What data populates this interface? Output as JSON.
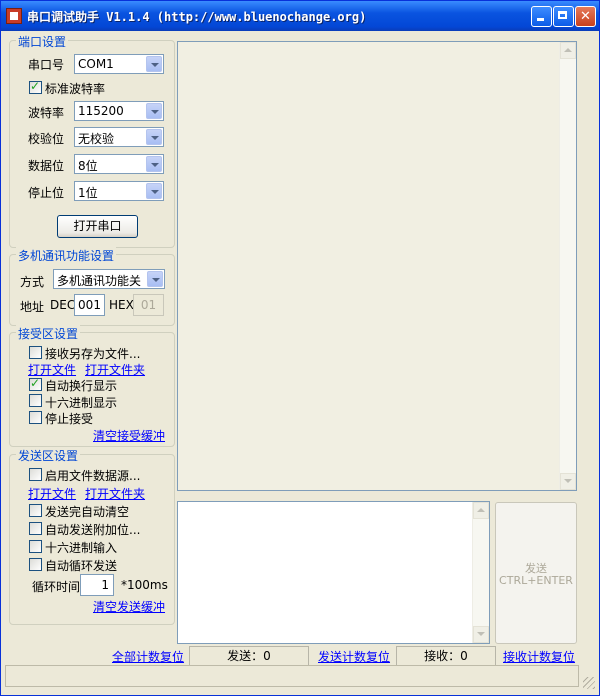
{
  "title": "串口调试助手 V1.1.4 (http://www.bluenochange.org)",
  "port_settings": {
    "title": "端口设置",
    "port_label": "串口号",
    "port_value": "COM1",
    "std_baud_label": "标准波特率",
    "baud_label": "波特率",
    "baud_value": "115200",
    "parity_label": "校验位",
    "parity_value": "无校验",
    "databits_label": "数据位",
    "databits_value": "8位",
    "stopbits_label": "停止位",
    "stopbits_value": "1位",
    "open_button": "打开串口"
  },
  "multi": {
    "title": "多机通讯功能设置",
    "mode_label": "方式",
    "mode_value": "多机通讯功能关",
    "addr_label": "地址",
    "dec_label": "DEC",
    "dec_value": "001",
    "hex_label": "HEX",
    "hex_value": "01"
  },
  "recv": {
    "title": "接受区设置",
    "save_as": "接收另存为文件...",
    "open_file": "打开文件",
    "open_folder": "打开文件夹",
    "auto_newline": "自动换行显示",
    "hex_display": "十六进制显示",
    "stop_recv": "停止接受",
    "clear": "清空接受缓冲"
  },
  "send": {
    "title": "发送区设置",
    "file_source": "启用文件数据源...",
    "open_file": "打开文件",
    "open_folder": "打开文件夹",
    "auto_clear": "发送完自动清空",
    "auto_append": "自动发送附加位...",
    "hex_input": "十六进制输入",
    "auto_loop": "自动循环发送",
    "loop_label": "循环时间",
    "loop_value": "1",
    "loop_unit": "*100ms",
    "clear": "清空发送缓冲",
    "send_button_line1": "发送",
    "send_button_line2": "CTRL+ENTER"
  },
  "counters": {
    "reset_all": "全部计数复位",
    "sent": "发送：0",
    "reset_sent": "发送计数复位",
    "received": "接收：0",
    "reset_recv": "接收计数复位"
  }
}
